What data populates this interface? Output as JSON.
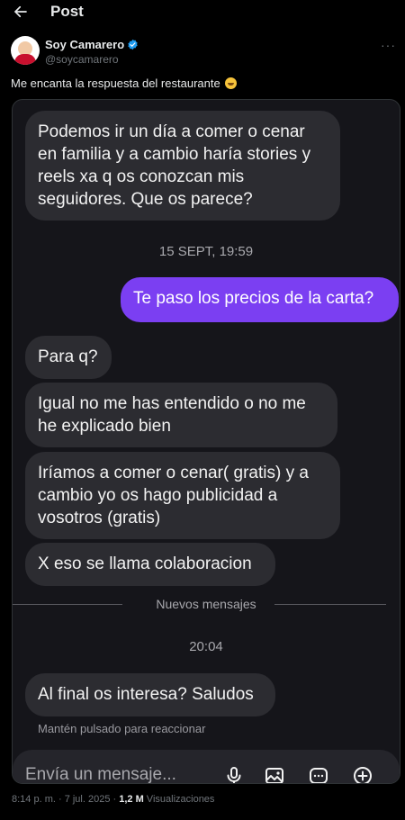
{
  "header": {
    "title": "Post"
  },
  "author": {
    "name": "Soy Camarero",
    "handle": "@soycamarero"
  },
  "post": {
    "text": "Me encanta la respuesta del restaurante"
  },
  "chat": {
    "msg1": "Podemos ir un día a comer o cenar en familia y a cambio haría stories y reels xa q os conozcan mis seguidores. Que os parece?",
    "time1": "15 SEPT, 19:59",
    "msg2": "Te paso los precios de la carta?",
    "msg3": "Para q?",
    "msg4": "Igual no me has entendido o no me he explicado bien",
    "msg5": "Iríamos a comer o cenar( gratis) y a cambio yo os hago publicidad a vosotros (gratis)",
    "msg6": "X eso se llama colaboracion",
    "new_messages": "Nuevos mensajes",
    "time2": "20:04",
    "msg7": "Al final os interesa? Saludos",
    "hint": "Mantén pulsado para reaccionar",
    "composer_placeholder": "Envía un mensaje..."
  },
  "footer": {
    "timestamp": "8:14 p. m. · 7 jul. 2025 · ",
    "views_count": "1,2 M",
    "views_label": " Visualizaciones"
  },
  "colors": {
    "verified": "#1d9bf0",
    "my_bubble": "#7b3ff2",
    "other_bubble": "#2c2c31"
  }
}
